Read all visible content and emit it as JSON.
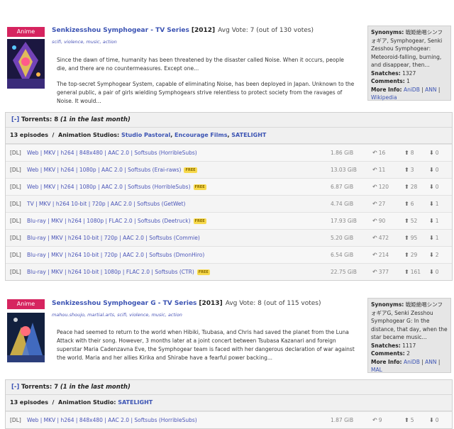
{
  "series": [
    {
      "badge": "Anime",
      "title": "Senkizesshou Symphogear - TV Series",
      "year": "[2012]",
      "vote": "Avg Vote: 7 (out of 130 votes)",
      "tags": [
        "scifi",
        "violence",
        "music",
        "action"
      ],
      "description": [
        "Since the dawn of time, humanity has been threatened by the disaster called Noise. When it occurs, people die, and there are no countermeasures. Except one...",
        "The top-secret Symphogear System, capable of eliminating Noise, has been deployed in Japan. Unknown to the general public, a pair of girls wielding Symphogears strive relentless to protect society from the ravages of Noise. It would..."
      ],
      "info": {
        "synonyms_label": "Synonyms:",
        "synonyms": "戦姫絶唱シンフォギア, Symphogear, Senki Zesshou Symphogear: Meteoroid-falling, burning, and disappear, then...",
        "snatches_label": "Snatches:",
        "snatches": "1327",
        "comments_label": "Comments:",
        "comments": "1",
        "more_label": "More Info:",
        "links": [
          "AniDB",
          "ANN",
          "Wikipedia"
        ]
      },
      "torrents_toggle": "[-]",
      "torrents_label": "Torrents: 8",
      "torrents_recent": "(1 in the last month)",
      "episodes": "13 episodes",
      "studios_label": "Animation Studios:",
      "studios": [
        "Studio Pastoral",
        "Encourage Films",
        "SATELIGHT"
      ],
      "rows": [
        {
          "dl": "[DL]",
          "fmt": "Web | MKV | h264 | 848x480 | AAC 2.0 | Softsubs (HorribleSubs)",
          "free": false,
          "size": "1.86 GiB",
          "snatch": "16",
          "seed": "8",
          "leech": "0"
        },
        {
          "dl": "[DL]",
          "fmt": "Web | MKV | h264 | 1080p | AAC 2.0 | Softsubs (Erai-raws)",
          "free": true,
          "size": "13.03 GiB",
          "snatch": "11",
          "seed": "3",
          "leech": "0"
        },
        {
          "dl": "[DL]",
          "fmt": "Web | MKV | h264 | 1080p | AAC 2.0 | Softsubs (HorribleSubs)",
          "free": true,
          "size": "6.87 GiB",
          "snatch": "120",
          "seed": "28",
          "leech": "0"
        },
        {
          "dl": "[DL]",
          "fmt": "TV | MKV | h264 10-bit | 720p | AAC 2.0 | Softsubs (GetWet)",
          "free": false,
          "size": "4.74 GiB",
          "snatch": "27",
          "seed": "6",
          "leech": "1"
        },
        {
          "dl": "[DL]",
          "fmt": "Blu-ray | MKV | h264 | 1080p | FLAC 2.0 | Softsubs (Deetruck)",
          "free": true,
          "size": "17.93 GiB",
          "snatch": "90",
          "seed": "52",
          "leech": "1"
        },
        {
          "dl": "[DL]",
          "fmt": "Blu-ray | MKV | h264 10-bit | 720p | AAC 2.0 | Softsubs (Commie)",
          "free": false,
          "size": "5.20 GiB",
          "snatch": "472",
          "seed": "95",
          "leech": "1"
        },
        {
          "dl": "[DL]",
          "fmt": "Blu-ray | MKV | h264 10-bit | 720p | AAC 2.0 | Softsubs (DmonHiro)",
          "free": false,
          "size": "6.54 GiB",
          "snatch": "214",
          "seed": "29",
          "leech": "2"
        },
        {
          "dl": "[DL]",
          "fmt": "Blu-ray | MKV | h264 10-bit | 1080p | FLAC 2.0 | Softsubs (CTR)",
          "free": true,
          "size": "22.75 GiB",
          "snatch": "377",
          "seed": "161",
          "leech": "0"
        }
      ]
    },
    {
      "badge": "Anime",
      "title": "Senkizesshou Symphogear G - TV Series",
      "year": "[2013]",
      "vote": "Avg Vote: 8 (out of 115 votes)",
      "tags": [
        "mahou.shoujo",
        "martial.arts",
        "scifi",
        "violence",
        "music",
        "action"
      ],
      "description": [
        "Peace had seemed to return to the world when Hibiki, Tsubasa, and Chris had saved the planet from the Luna Attack with their song. However, 3 months later at a joint concert between Tsubasa Kazanari and foreign superstar Maria Cadenzavna Eve, the Symphogear team is faced with her dangerous declaration of war against the world. Maria and her allies Kirika and Shirabe have a fearful power backing..."
      ],
      "info": {
        "synonyms_label": "Synonyms:",
        "synonyms": "戦姫絶唱シンフォギアG, Senki Zesshou Symphogear G: In the distance, that day, when the star became music...",
        "snatches_label": "Snatches:",
        "snatches": "1117",
        "comments_label": "Comments:",
        "comments": "2",
        "more_label": "More Info:",
        "links": [
          "AniDB",
          "ANN",
          "MAL"
        ]
      },
      "torrents_toggle": "[-]",
      "torrents_label": "Torrents: 7",
      "torrents_recent": "(1 in the last month)",
      "episodes": "13 episodes",
      "studios_label": "Animation Studio:",
      "studios": [
        "SATELIGHT"
      ],
      "rows": [
        {
          "dl": "[DL]",
          "fmt": "Web | MKV | h264 | 848x480 | AAC 2.0 | Softsubs (HorribleSubs)",
          "free": false,
          "size": "1.87 GiB",
          "snatch": "9",
          "seed": "5",
          "leech": "0"
        }
      ]
    }
  ],
  "free_label": "FREE",
  "colors": {
    "badge": "#d6245f",
    "link": "#3b53b3",
    "panel": "#f0f0f0",
    "info": "#e6e6e6"
  }
}
